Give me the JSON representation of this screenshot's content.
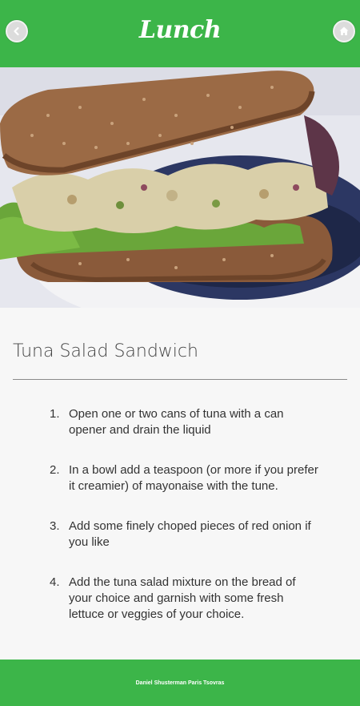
{
  "header": {
    "title": "Lunch",
    "back_icon": "chevron-left-icon",
    "home_icon": "home-icon",
    "color": "#3cb549"
  },
  "recipe": {
    "title": "Tuna Salad Sandwich",
    "steps": [
      {
        "num": "1.",
        "text": "Open one or two cans of tuna with a can opener and drain the liquid"
      },
      {
        "num": "2.",
        "text": "In a bowl add a teaspoon (or more if you prefer it creamier) of mayonaise with the tune."
      },
      {
        "num": "3.",
        "text": "Add some finely choped pieces of red onion if you like"
      },
      {
        "num": "4.",
        "text": "Add the tuna salad mixture on the bread of your choice and garnish with some fresh lettuce or veggies of your choice."
      }
    ]
  },
  "footer": {
    "text": "Daniel Shusterman Paris Tsovras"
  }
}
